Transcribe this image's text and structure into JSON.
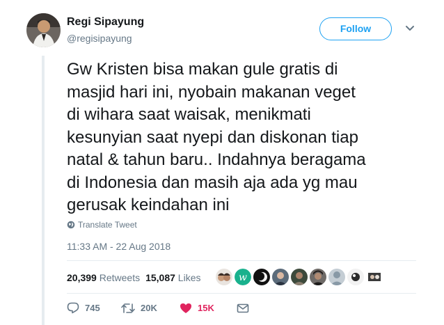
{
  "user": {
    "name": "Regi Sipayung",
    "handle": "@regisipayung"
  },
  "follow_label": "Follow",
  "tweet": {
    "text": "Gw Kristen bisa makan gule gratis di\nmasjid hari ini, nyobain makanan veget\ndi wihara saat waisak, menikmati\nkesunyian saat nyepi dan diskonan tiap\nnatal & tahun baru.. Indahnya beragama\ndi Indonesia dan masih aja ada yg mau\ngerusak keindahan ini",
    "translate_label": "Translate Tweet",
    "timestamp": "11:33 AM - 22 Aug 2018"
  },
  "stats": {
    "retweets_count": "20,399",
    "retweets_label": "Retweets",
    "likes_count": "15,087",
    "likes_label": "Likes"
  },
  "actions": {
    "reply_count": "745",
    "retweet_count": "20K",
    "like_count": "15K"
  },
  "icons": [
    "globe-icon",
    "reply-icon",
    "retweet-icon",
    "heart-icon",
    "direct-message-icon",
    "chevron-down-icon"
  ],
  "colors": {
    "accent": "#1da1f2",
    "like": "#e0245e",
    "secondary_text": "#657786",
    "divider": "#e6ecf0"
  }
}
